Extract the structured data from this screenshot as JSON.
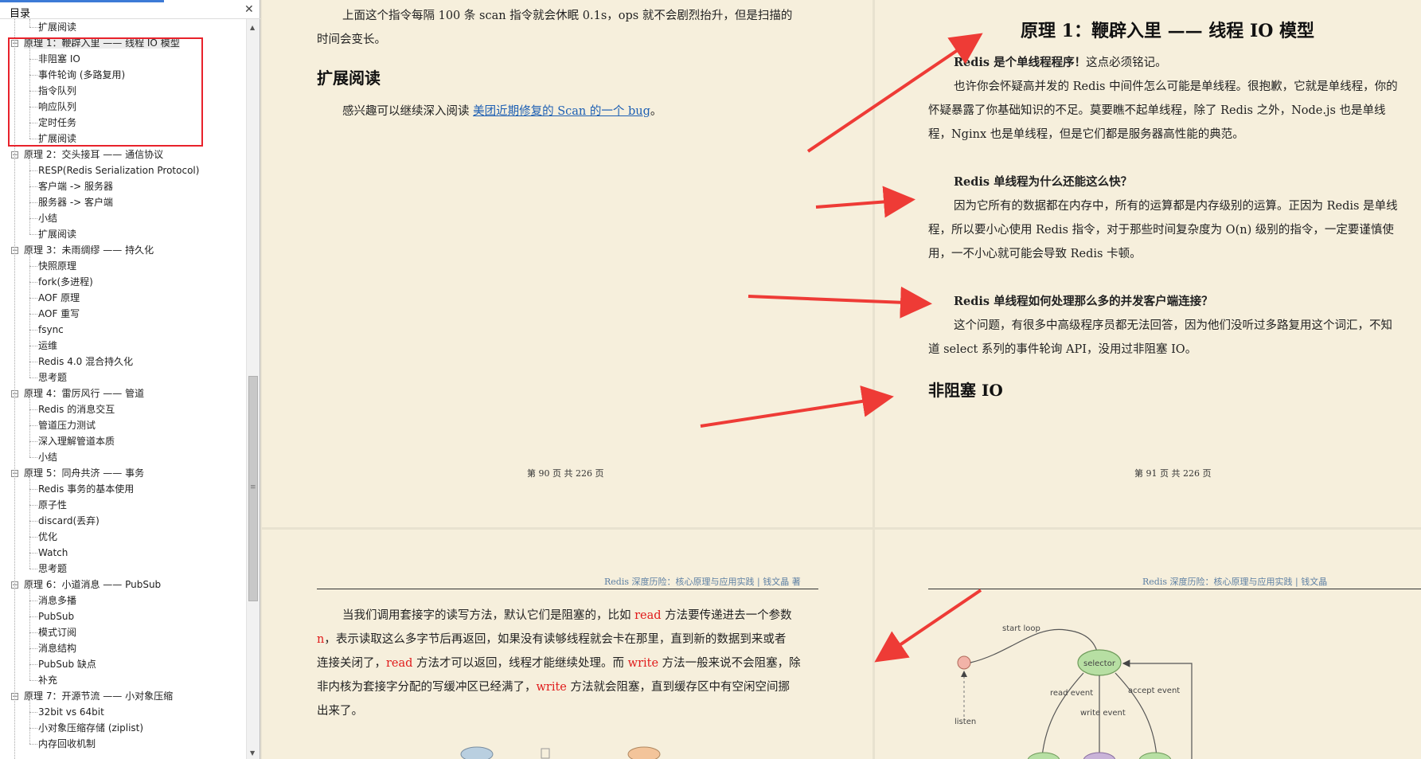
{
  "sidebar": {
    "title": "目录",
    "items": [
      {
        "label": "扩展阅读",
        "level": 2
      },
      {
        "label": "原理 1：鞭辟入里 —— 线程 IO 模型",
        "level": 1,
        "selected": true
      },
      {
        "label": "非阻塞 IO",
        "level": 2
      },
      {
        "label": "事件轮询 (多路复用)",
        "level": 2
      },
      {
        "label": "指令队列",
        "level": 2
      },
      {
        "label": "响应队列",
        "level": 2
      },
      {
        "label": "定时任务",
        "level": 2
      },
      {
        "label": "扩展阅读",
        "level": 2
      },
      {
        "label": "原理 2：交头接耳 —— 通信协议",
        "level": 1
      },
      {
        "label": "RESP(Redis Serialization Protocol)",
        "level": 2
      },
      {
        "label": "客户端 -> 服务器",
        "level": 2
      },
      {
        "label": "服务器 -> 客户端",
        "level": 2
      },
      {
        "label": "小结",
        "level": 2
      },
      {
        "label": "扩展阅读",
        "level": 2
      },
      {
        "label": "原理 3：未雨绸缪 —— 持久化",
        "level": 1
      },
      {
        "label": "快照原理",
        "level": 2
      },
      {
        "label": "fork(多进程)",
        "level": 2
      },
      {
        "label": "AOF 原理",
        "level": 2
      },
      {
        "label": "AOF 重写",
        "level": 2
      },
      {
        "label": "fsync",
        "level": 2
      },
      {
        "label": "运维",
        "level": 2
      },
      {
        "label": "Redis 4.0 混合持久化",
        "level": 2
      },
      {
        "label": "思考题",
        "level": 2
      },
      {
        "label": "原理 4：雷厉风行 —— 管道",
        "level": 1
      },
      {
        "label": "Redis 的消息交互",
        "level": 2
      },
      {
        "label": "管道压力测试",
        "level": 2
      },
      {
        "label": "深入理解管道本质",
        "level": 2
      },
      {
        "label": "小结",
        "level": 2
      },
      {
        "label": "原理 5：同舟共济 —— 事务",
        "level": 1
      },
      {
        "label": "Redis 事务的基本使用",
        "level": 2
      },
      {
        "label": "原子性",
        "level": 2
      },
      {
        "label": "discard(丢弃)",
        "level": 2
      },
      {
        "label": "优化",
        "level": 2
      },
      {
        "label": "Watch",
        "level": 2
      },
      {
        "label": "思考题",
        "level": 2
      },
      {
        "label": "原理 6：小道消息 —— PubSub",
        "level": 1
      },
      {
        "label": "消息多播",
        "level": 2
      },
      {
        "label": "PubSub",
        "level": 2
      },
      {
        "label": "模式订阅",
        "level": 2
      },
      {
        "label": "消息结构",
        "level": 2
      },
      {
        "label": "PubSub 缺点",
        "level": 2
      },
      {
        "label": "补充",
        "level": 2
      },
      {
        "label": "原理 7：开源节流 —— 小对象压缩",
        "level": 1
      },
      {
        "label": "32bit vs 64bit",
        "level": 2
      },
      {
        "label": "小对象压缩存储 (ziplist)",
        "level": 2
      },
      {
        "label": "内存回收机制",
        "level": 2
      }
    ]
  },
  "page90": {
    "para1": "上面这个指令每隔 100 条 scan 指令就会休眠 0.1s，ops 就不会剧烈抬升，但是扫描的",
    "para1b": "时间会变长。",
    "heading": "扩展阅读",
    "read_prefix": "感兴趣可以继续深入阅读 ",
    "read_link": "美团近期修复的 Scan 的一个 bug",
    "read_suffix": "。",
    "footer": "第 90 页 共 226 页"
  },
  "page91": {
    "title": "原理 1：鞭辟入里 —— 线程 IO 模型",
    "q1": "Redis 是个单线程程序！",
    "q1_tail": "这点必须铭记。",
    "p1a": "也许你会怀疑高并发的 Redis 中间件怎么可能是单线程。很抱歉，它就是单线程，你的",
    "p1b": "怀疑暴露了你基础知识的不足。莫要瞧不起单线程，除了 Redis 之外，Node.js 也是单线",
    "p1c": "程，Nginx 也是单线程，但是它们都是服务器高性能的典范。",
    "q2": "Redis 单线程为什么还能这么快？",
    "p2a": "因为它所有的数据都在内存中，所有的运算都是内存级别的运算。正因为 Redis 是单线",
    "p2b": "程，所以要小心使用 Redis 指令，对于那些时间复杂度为 O(n) 级别的指令，一定要谨慎使",
    "p2c": "用，一不小心就可能会导致 Redis 卡顿。",
    "q3": "Redis 单线程如何处理那么多的并发客户端连接？",
    "p3a": "这个问题，有很多中高级程序员都无法回答，因为他们没听过多路复用这个词汇，不知",
    "p3b": "道 select 系列的事件轮询 API，没用过非阻塞 IO。",
    "heading": "非阻塞 IO",
    "footer": "第 91 页 共 226 页"
  },
  "page92": {
    "runhead": "Redis 深度历险：核心原理与应用实践   | 钱文晶 著",
    "l1a": "当我们调用套接字的读写方法，默认它们是阻塞的，比如 ",
    "l1r": "read",
    "l1b": " 方法要传递进去一个参数",
    "l2r": "n",
    "l2b": "，表示读取这么多字节后再返回，如果没有读够线程就会卡在那里，直到新的数据到来或者",
    "l3a": "连接关闭了，",
    "l3r": "read",
    "l3b": " 方法才可以返回，线程才能继续处理。而 ",
    "l3r2": "write",
    "l3c": " 方法一般来说不会阻塞，除",
    "l4a": "非内核为套接字分配的写缓冲区已经满了，",
    "l4r": "write",
    "l4b": " 方法就会阻塞，直到缓存区中有空闲空间挪",
    "l5": "出来了。"
  },
  "page93": {
    "runhead": "Redis 深度历险：核心原理与应用实践   | 钱文晶",
    "diagram": {
      "start_loop": "start loop",
      "selector": "selector",
      "read_event": "read event",
      "write_event": "write event",
      "accept_event": "accept event",
      "listen": "listen"
    }
  },
  "colors": {
    "highlight": "#e8222b",
    "arrow": "#ee3b36",
    "page": "#f6efdc",
    "link": "#1d5fb3",
    "selector_fill": "#b7dfa3",
    "listen_fill": "#f2b3a8"
  }
}
